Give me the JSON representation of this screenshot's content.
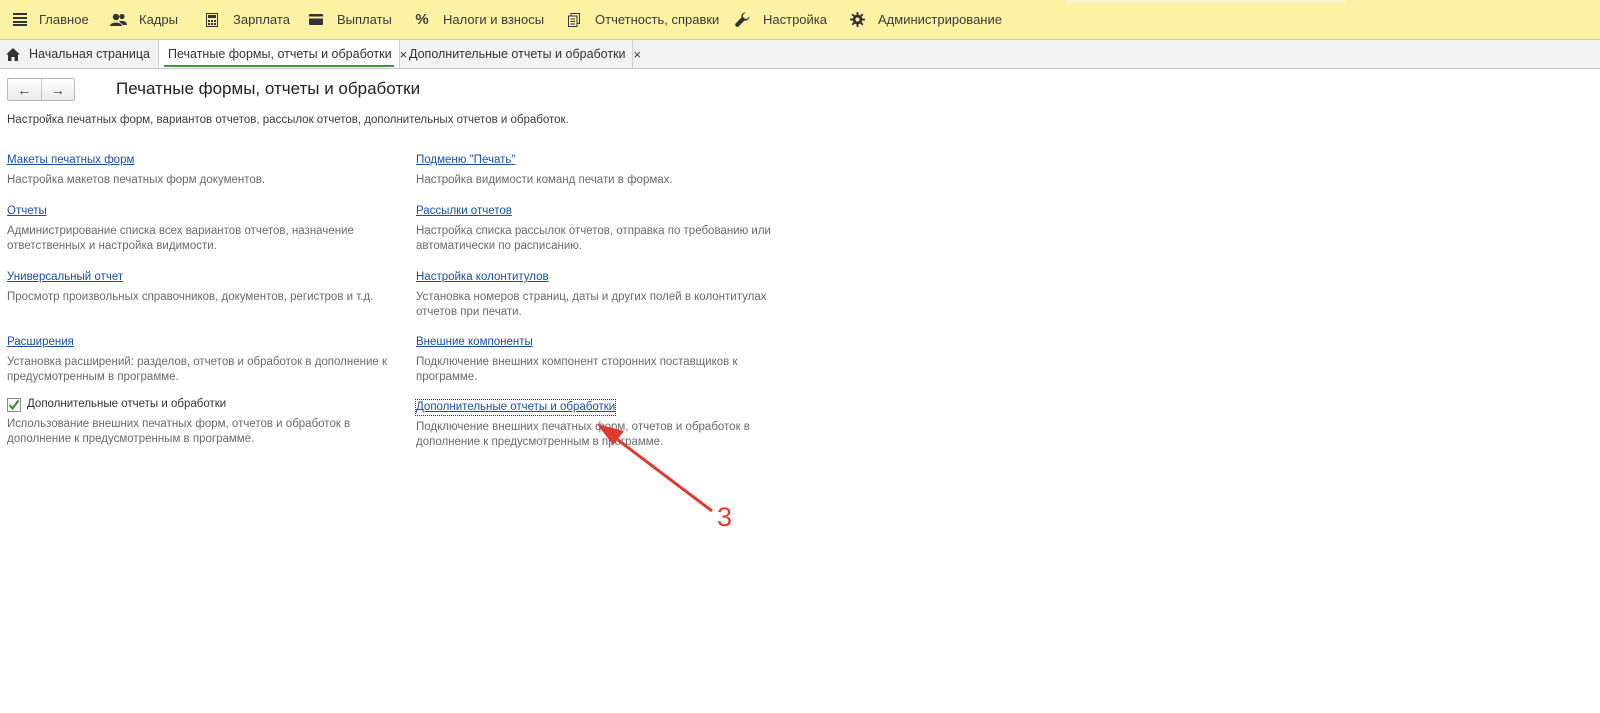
{
  "menu": {
    "items": [
      {
        "label": "Главное",
        "icon": "hamburger-icon"
      },
      {
        "label": "Кадры",
        "icon": "people-icon"
      },
      {
        "label": "Зарплата",
        "icon": "calculator-icon"
      },
      {
        "label": "Выплаты",
        "icon": "wallet-icon"
      },
      {
        "label": "Налоги и взносы",
        "icon": "percent-icon"
      },
      {
        "label": "Отчетность, справки",
        "icon": "documents-icon"
      },
      {
        "label": "Настройка",
        "icon": "wrench-icon"
      },
      {
        "label": "Администрирование",
        "icon": "gear-icon"
      }
    ]
  },
  "tabs": {
    "home": "Начальная страница",
    "active": "Печатные формы, отчеты и обработки",
    "extra": "Дополнительные отчеты и обработки",
    "close_glyph": "×"
  },
  "nav": {
    "back": "←",
    "forward": "→"
  },
  "page": {
    "title": "Печатные формы, отчеты и обработки",
    "subtitle": "Настройка печатных форм, вариантов отчетов, рассылок отчетов, дополнительных отчетов и обработок."
  },
  "left": [
    {
      "link": "Макеты печатных форм",
      "desc": "Настройка макетов печатных форм документов."
    },
    {
      "link": "Отчеты",
      "desc": "Администрирование списка всех вариантов отчетов, назначение ответственных и настройка видимости."
    },
    {
      "link": "Универсальный отчет",
      "desc": "Просмотр произвольных справочников, документов, регистров и т.д."
    },
    {
      "link": "Расширения",
      "desc": "Установка расширений: разделов, отчетов и обработок в дополнение к предусмотренным в программе."
    },
    {
      "checkbox_label": "Дополнительные отчеты и обработки",
      "checked": true,
      "desc": "Использование внешних печатных форм, отчетов и обработок в дополнение к предусмотренным в программе."
    }
  ],
  "right": [
    {
      "link": "Подменю \"Печать\"",
      "desc": "Настройка видимости команд печати в формах."
    },
    {
      "link": "Рассылки отчетов",
      "desc": "Настройка списка рассылок отчетов, отправка по требованию или автоматически по расписанию."
    },
    {
      "link": "Настройка колонтитулов",
      "desc": "Установка номеров страниц, даты и других полей в колонтитулах отчетов при печати."
    },
    {
      "link": "Внешние компоненты",
      "desc": "Подключение внешних компонент сторонних поставщиков к программе."
    },
    {
      "link": "Дополнительные отчеты и обработки",
      "desc": "Подключение внешних печатных форм, отчетов и обработок в дополнение к предусмотренным в программе."
    }
  ],
  "annotation": {
    "number": "3",
    "color": "#e03a2e"
  }
}
